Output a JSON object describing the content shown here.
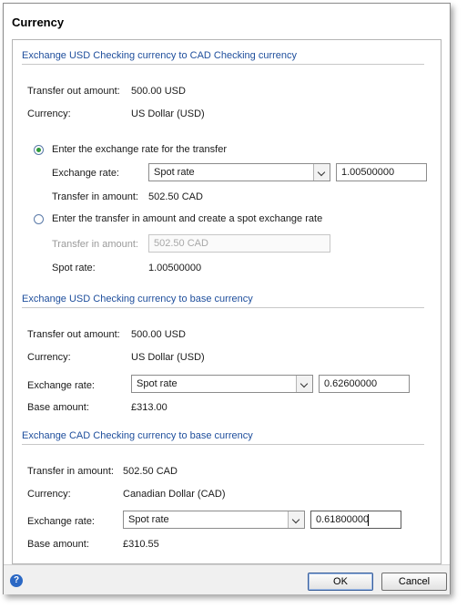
{
  "dialog": {
    "title": "Currency",
    "ok_label": "OK",
    "cancel_label": "Cancel",
    "help_glyph": "?"
  },
  "section1": {
    "title": "Exchange USD Checking currency to CAD Checking currency",
    "transfer_out_label": "Transfer out amount:",
    "transfer_out_value": "500.00 USD",
    "currency_label": "Currency:",
    "currency_value": "US Dollar (USD)",
    "option1": {
      "label": "Enter the exchange rate for the transfer",
      "selected": true,
      "exchange_rate_label": "Exchange rate:",
      "exchange_rate_type": "Spot rate",
      "exchange_rate_value": "1.00500000",
      "transfer_in_label": "Transfer in amount:",
      "transfer_in_value": "502.50 CAD"
    },
    "option2": {
      "label": "Enter the transfer in amount and create a spot exchange rate",
      "selected": false,
      "transfer_in_label": "Transfer in amount:",
      "transfer_in_value": "502.50 CAD",
      "spot_rate_label": "Spot rate:",
      "spot_rate_value": "1.00500000"
    }
  },
  "section2": {
    "title": "Exchange USD Checking currency to base currency",
    "transfer_out_label": "Transfer out amount:",
    "transfer_out_value": "500.00 USD",
    "currency_label": "Currency:",
    "currency_value": "US Dollar (USD)",
    "exchange_rate_label": "Exchange rate:",
    "exchange_rate_type": "Spot rate",
    "exchange_rate_value": "0.62600000",
    "base_amount_label": "Base amount:",
    "base_amount_value": "£313.00"
  },
  "section3": {
    "title": "Exchange CAD Checking currency to base currency",
    "transfer_in_label": "Transfer in amount:",
    "transfer_in_value": "502.50 CAD",
    "currency_label": "Currency:",
    "currency_value": "Canadian Dollar (CAD)",
    "exchange_rate_label": "Exchange rate:",
    "exchange_rate_type": "Spot rate",
    "exchange_rate_value": "0.61800000",
    "base_amount_label": "Base amount:",
    "base_amount_value": "£310.55"
  },
  "colors": {
    "section_title": "#1e4e9c",
    "radio_selected": "#2e9a3a",
    "help_icon": "#2b68c4"
  }
}
